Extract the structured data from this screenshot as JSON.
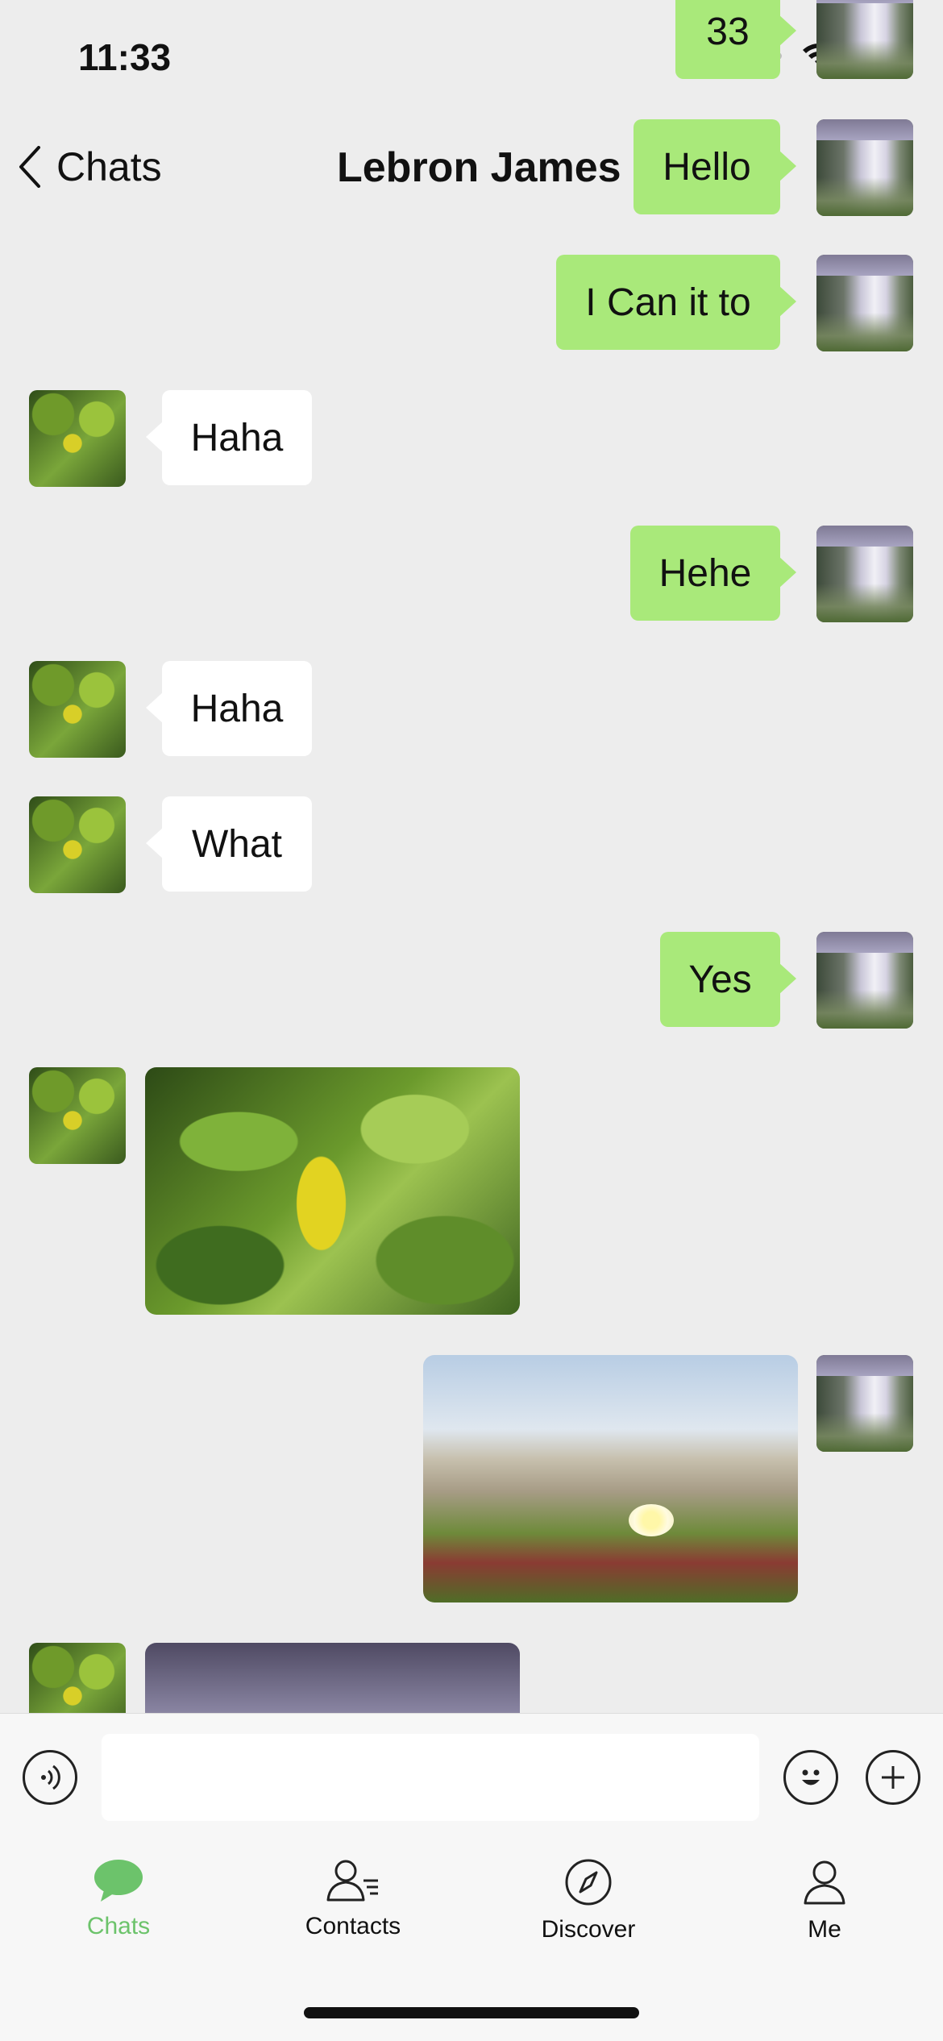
{
  "status_bar": {
    "time": "11:33"
  },
  "header": {
    "back_label": "Chats",
    "title": "Lebron James"
  },
  "messages": [
    {
      "direction": "out",
      "type": "text",
      "text": "33"
    },
    {
      "direction": "out",
      "type": "text",
      "text": "Hello"
    },
    {
      "direction": "out",
      "type": "text",
      "text": "I Can it to"
    },
    {
      "direction": "in",
      "type": "text",
      "text": "Haha"
    },
    {
      "direction": "out",
      "type": "text",
      "text": "Hehe"
    },
    {
      "direction": "in",
      "type": "text",
      "text": "Haha"
    },
    {
      "direction": "in",
      "type": "text",
      "text": "What"
    },
    {
      "direction": "out",
      "type": "text",
      "text": "Yes"
    },
    {
      "direction": "in",
      "type": "image",
      "image": "green-leaves-photo"
    },
    {
      "direction": "out",
      "type": "image",
      "image": "beach-flower-photo"
    },
    {
      "direction": "in",
      "type": "image",
      "image": "waterfall-photo"
    }
  ],
  "input": {
    "value": "",
    "placeholder": ""
  },
  "tabs": [
    {
      "label": "Chats",
      "icon": "chat-bubble-icon",
      "active": true
    },
    {
      "label": "Contacts",
      "icon": "contacts-icon",
      "active": false
    },
    {
      "label": "Discover",
      "icon": "compass-icon",
      "active": false
    },
    {
      "label": "Me",
      "icon": "person-icon",
      "active": false
    }
  ],
  "colors": {
    "background": "#ededed",
    "outgoing_bubble": "#a9e97a",
    "incoming_bubble": "#ffffff",
    "active_tab": "#6cc36b"
  }
}
